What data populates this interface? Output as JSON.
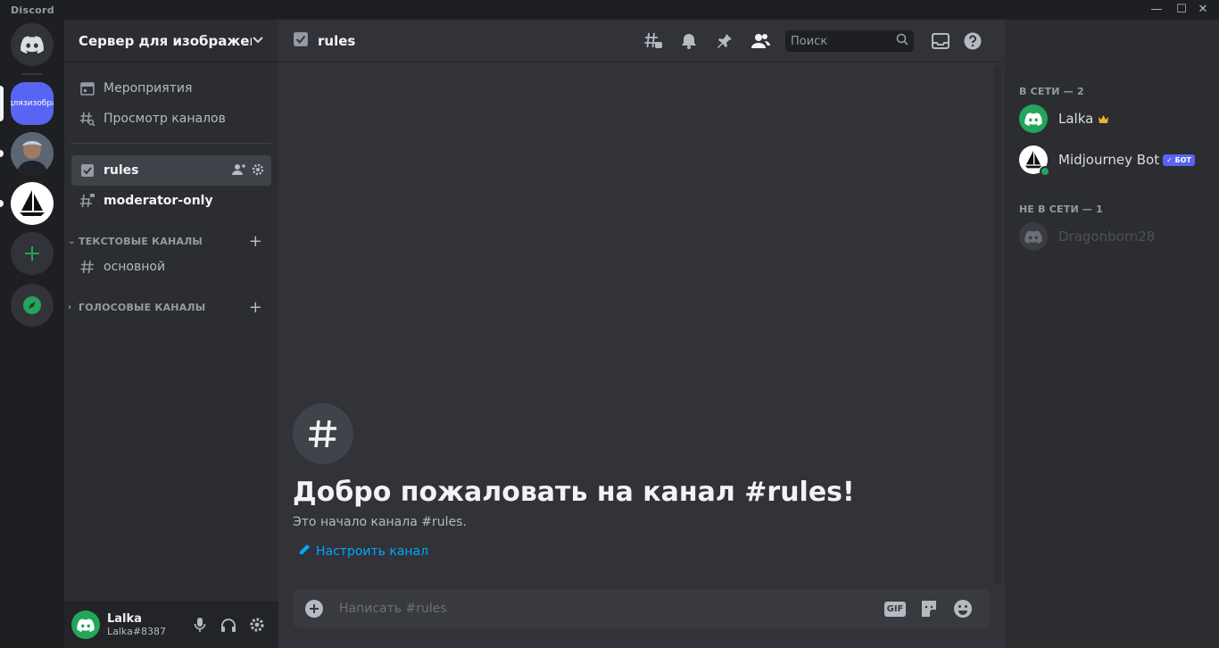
{
  "app": {
    "title": "Discord"
  },
  "servers": {
    "server1_label": "длязизобра"
  },
  "channel_sidebar": {
    "guild_name": "Сервер для изображен...",
    "events_label": "Мероприятия",
    "browse_label": "Просмотр каналов",
    "channels_top": [
      {
        "name": "rules",
        "active": true
      },
      {
        "name": "moderator-only",
        "active": false
      }
    ],
    "categories": [
      {
        "name": "ТЕКСТОВЫЕ КАНАЛЫ",
        "channels": [
          "основной"
        ]
      },
      {
        "name": "ГОЛОСОВЫЕ КАНАЛЫ",
        "channels": []
      }
    ]
  },
  "user_panel": {
    "username": "Lalka",
    "tag": "Lalka#8387"
  },
  "header": {
    "channel_name": "rules",
    "search_placeholder": "Поиск"
  },
  "welcome": {
    "title": "Добро пожаловать на канал #rules!",
    "subtitle": "Это начало канала #rules.",
    "edit_label": "Настроить канал"
  },
  "composer": {
    "placeholder": "Написать #rules",
    "gif_label": "GIF"
  },
  "members": {
    "online_header": "В СЕТИ — 2",
    "offline_header": "НЕ В СЕТИ — 1",
    "online": [
      {
        "name": "Lalka",
        "owner": true
      },
      {
        "name": "Midjourney Bot",
        "bot_badge": "✓ БОТ"
      }
    ],
    "offline": [
      {
        "name": "Dragonborn28"
      }
    ]
  },
  "colors": {
    "accent": "#5865f2",
    "online_green": "#23a55a",
    "link_blue": "#00a8fc"
  }
}
